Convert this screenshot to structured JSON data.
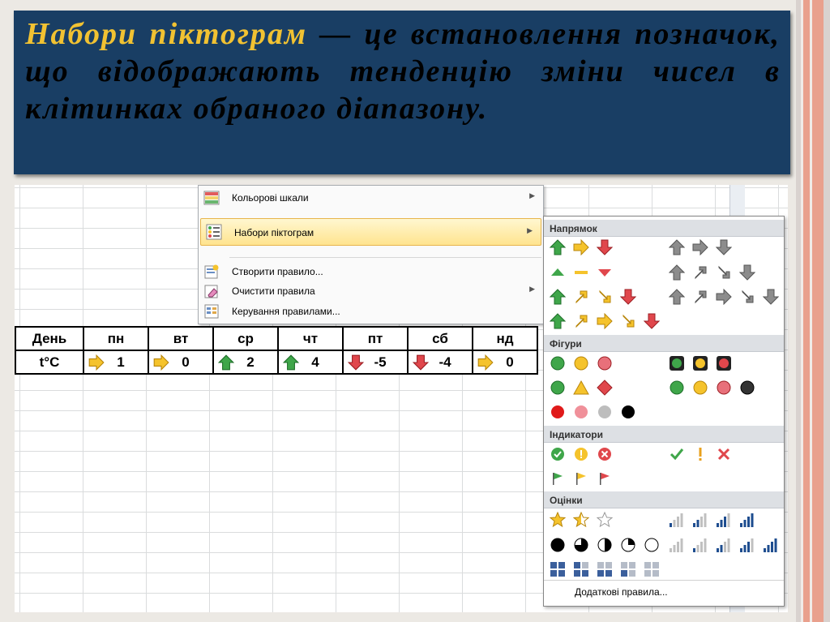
{
  "banner": {
    "term": "Набори піктограм",
    "rest": " — це встановлення позначок, що відображають тенденцію зміни чисел в клітинках обраного діапазону."
  },
  "table": {
    "header_label": "День",
    "row_label": "t°C",
    "days": [
      "пн",
      "вт",
      "ср",
      "чт",
      "пт",
      "сб",
      "нд"
    ],
    "values": [
      "1",
      "0",
      "2",
      "4",
      "-5",
      "-4",
      "0"
    ],
    "icons": [
      "arrow-right-icon",
      "arrow-right-icon",
      "arrow-up-icon",
      "arrow-up-icon",
      "arrow-down-icon",
      "arrow-down-icon",
      "arrow-right-icon"
    ]
  },
  "menu": {
    "color_scales": "Кольорові шкали",
    "icon_sets": "Набори піктограм",
    "new_rule": "Створити правило...",
    "clear_rules": "Очистити правила",
    "manage_rules": "Керування правилами..."
  },
  "gallery": {
    "sections": [
      "Напрямок",
      "Фігури",
      "Індикатори",
      "Оцінки"
    ],
    "more_rules": "Додаткові правила..."
  },
  "colors": {
    "banner_bg": "#193e64",
    "term_color": "#f1c232",
    "arrow_green": "#3fa64a",
    "arrow_yellow": "#f5c32c",
    "arrow_red": "#e0474c"
  }
}
